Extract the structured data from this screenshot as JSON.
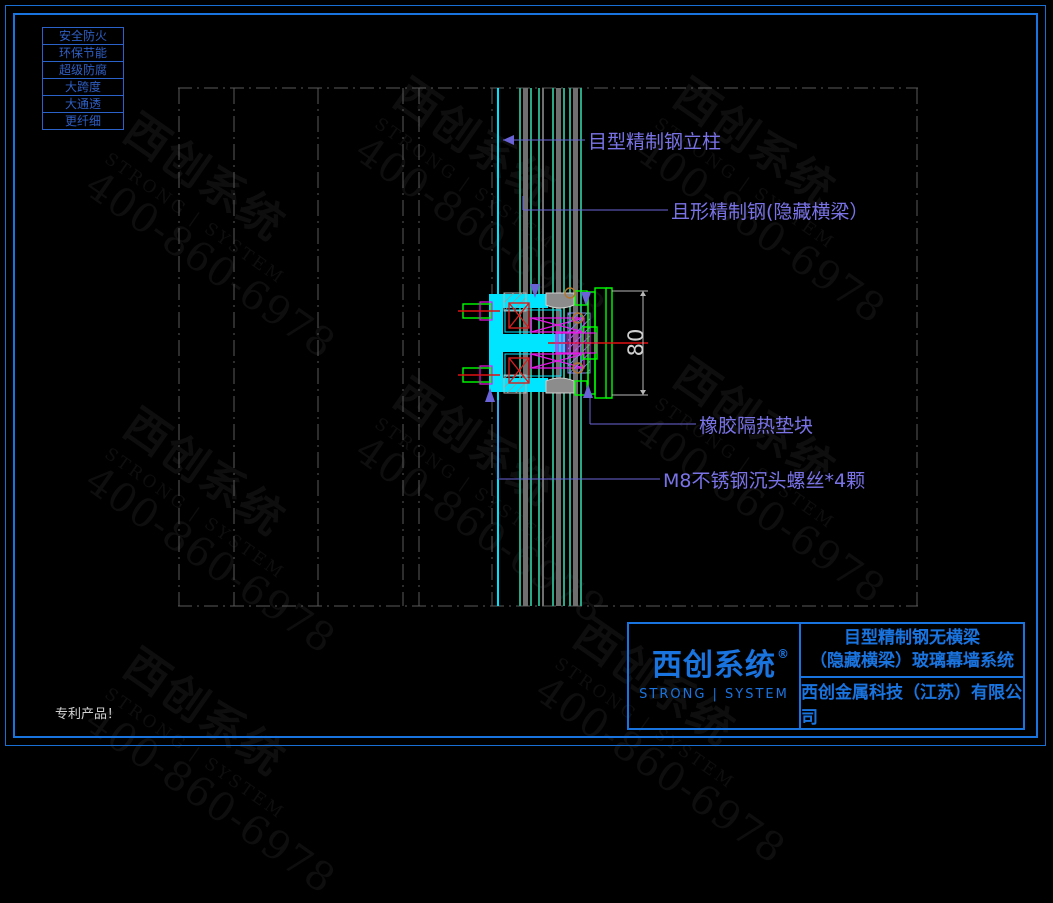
{
  "feature_tags": [
    {
      "label": "安全防火"
    },
    {
      "label": "环保节能"
    },
    {
      "label": "超级防腐"
    },
    {
      "label": "大跨度"
    },
    {
      "label": "大通透"
    },
    {
      "label": "更纤细"
    }
  ],
  "annotations": [
    {
      "id": "mullion",
      "label": "目型精制钢立柱"
    },
    {
      "id": "transom",
      "label": "且形精制钢(隐藏横梁）"
    },
    {
      "id": "rubber",
      "label": "橡胶隔热垫块"
    },
    {
      "id": "screw",
      "label": "M8不锈钢沉头螺丝*4颗"
    }
  ],
  "dimension": {
    "value": "80"
  },
  "title_block": {
    "logo_cn": "西创系统",
    "logo_reg": "®",
    "logo_en": "STRONG | SYSTEM",
    "title_line1": "目型精制钢无横梁",
    "title_line2": "（隐藏横梁）玻璃幕墙系统",
    "company": "西创金属科技（江苏）有限公司"
  },
  "footer": {
    "patent_note": "专利产品！"
  },
  "watermark": {
    "cn": "西创系统",
    "en": "STRONG | SYSTEM",
    "phone": "400-860-6978"
  },
  "colors": {
    "border_blue": "#1a74e0",
    "leader_purple": "#7a73e8",
    "steel_cyan": "#00e5ff",
    "gasket_green": "#00ff00",
    "glass_teal": "#2aa886",
    "dim_gray": "#cfcfcf",
    "background": "#000000"
  }
}
